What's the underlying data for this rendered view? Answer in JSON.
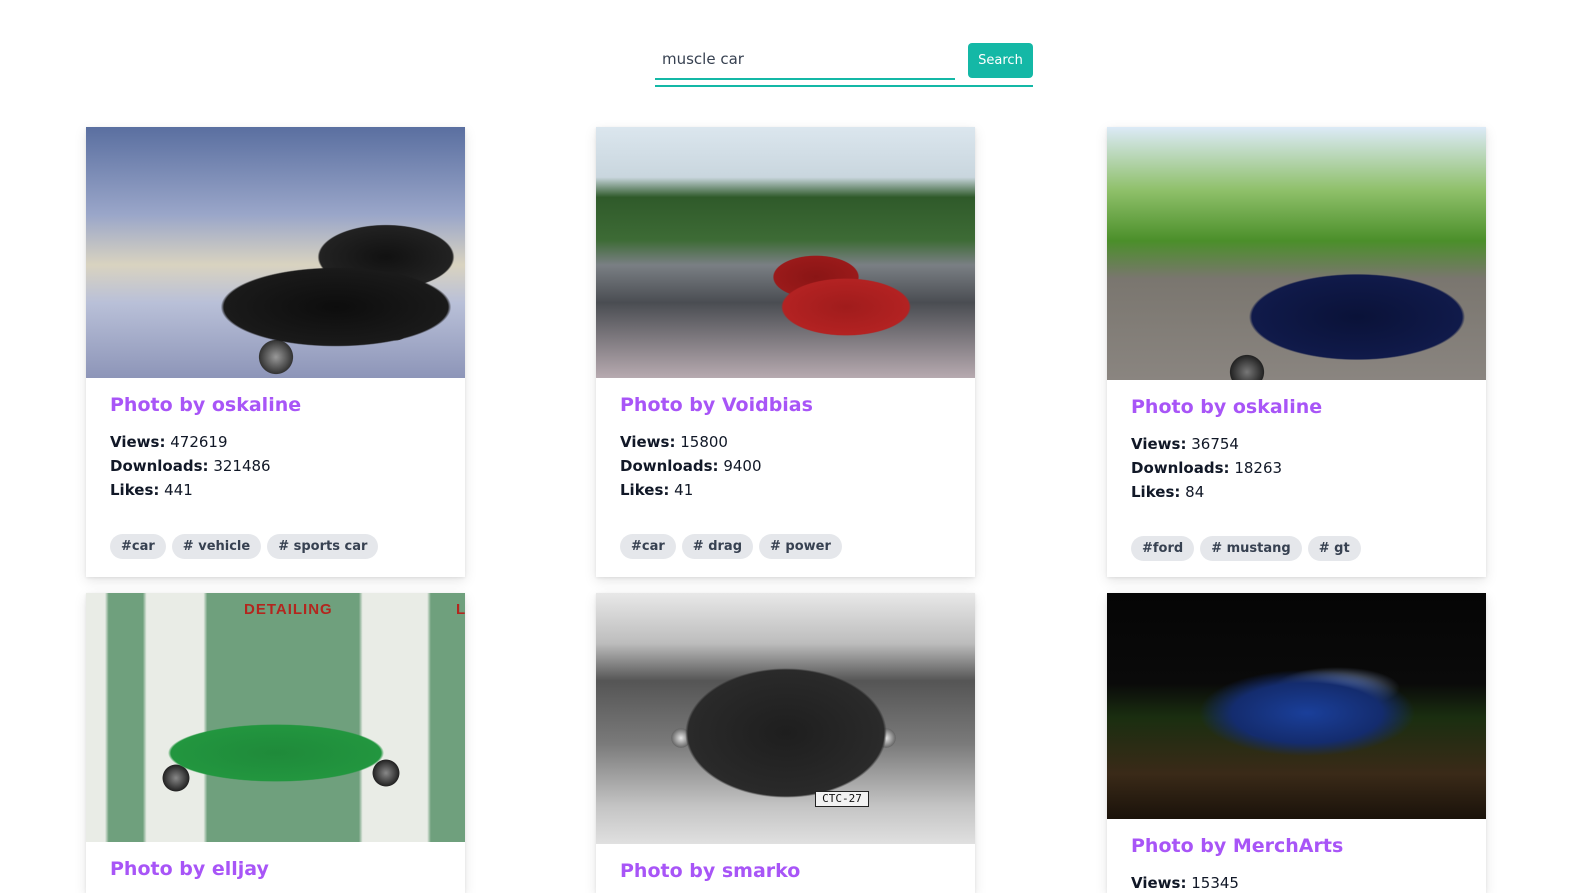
{
  "search": {
    "value": "muscle car",
    "button_label": "Search"
  },
  "labels": {
    "views": "Views:",
    "downloads": "Downloads:",
    "likes": "Likes:"
  },
  "cards": [
    {
      "title": "Photo by oskaline",
      "views": "472619",
      "downloads": "321486",
      "likes": "441",
      "tags": [
        "#car",
        "# vehicle",
        "# sports car"
      ]
    },
    {
      "title": "Photo by Voidbias",
      "views": "15800",
      "downloads": "9400",
      "likes": "41",
      "tags": [
        "#car",
        "# drag",
        "# power"
      ]
    },
    {
      "title": "Photo by oskaline",
      "views": "36754",
      "downloads": "18263",
      "likes": "84",
      "tags": [
        "#ford",
        "# mustang",
        "# gt"
      ]
    },
    {
      "title": "Photo by elljay",
      "photo_text": [
        "DETAILING",
        "L"
      ]
    },
    {
      "title": "Photo by smarko",
      "photo_text": [
        "CTC-27"
      ]
    },
    {
      "title": "Photo by MerchArts",
      "views": "15345"
    }
  ]
}
